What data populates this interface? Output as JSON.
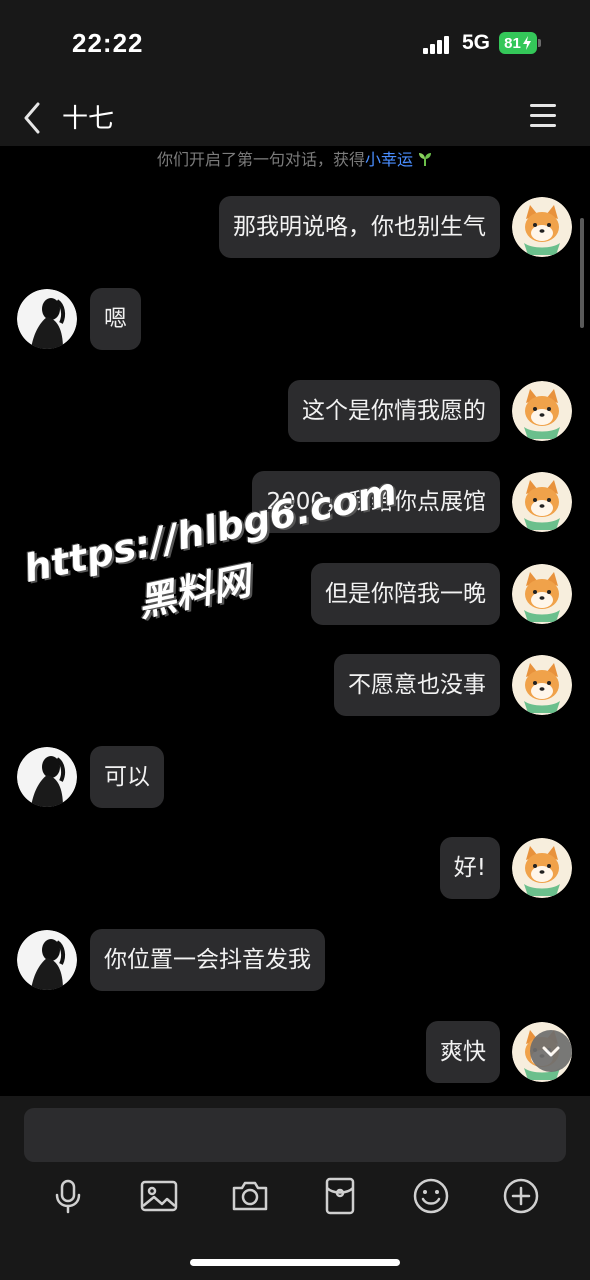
{
  "status_bar": {
    "time": "22:22",
    "network": "5G",
    "battery": "81"
  },
  "header": {
    "title": "十七"
  },
  "system_message": {
    "prefix": "你们开启了第一句对话，获得",
    "highlight": "小幸运"
  },
  "messages": [
    {
      "side": "out",
      "text": "那我明说咯，你也别生气"
    },
    {
      "side": "in",
      "text": "嗯"
    },
    {
      "side": "out",
      "text": "这个是你情我愿的"
    },
    {
      "side": "out",
      "text": "2000，我给你点展馆"
    },
    {
      "side": "out",
      "text": "但是你陪我一晚"
    },
    {
      "side": "out",
      "text": "不愿意也没事"
    },
    {
      "side": "in",
      "text": "可以"
    },
    {
      "side": "out",
      "text": "好!"
    },
    {
      "side": "in",
      "text": "你位置一会抖音发我"
    },
    {
      "side": "out",
      "text": "爽快"
    }
  ],
  "watermark": {
    "url": "https://hlbg6.com",
    "name": "黑料网"
  },
  "input": {
    "value": "",
    "placeholder": ""
  },
  "toolbar": [
    "microphone-icon",
    "image-icon",
    "camera-icon",
    "red-packet-icon",
    "emoji-icon",
    "add-icon"
  ],
  "colors": {
    "background": "#000000",
    "bubble": "#2c2c2e",
    "bar": "#181818",
    "battery": "#34c759",
    "link": "#4a8eff"
  }
}
